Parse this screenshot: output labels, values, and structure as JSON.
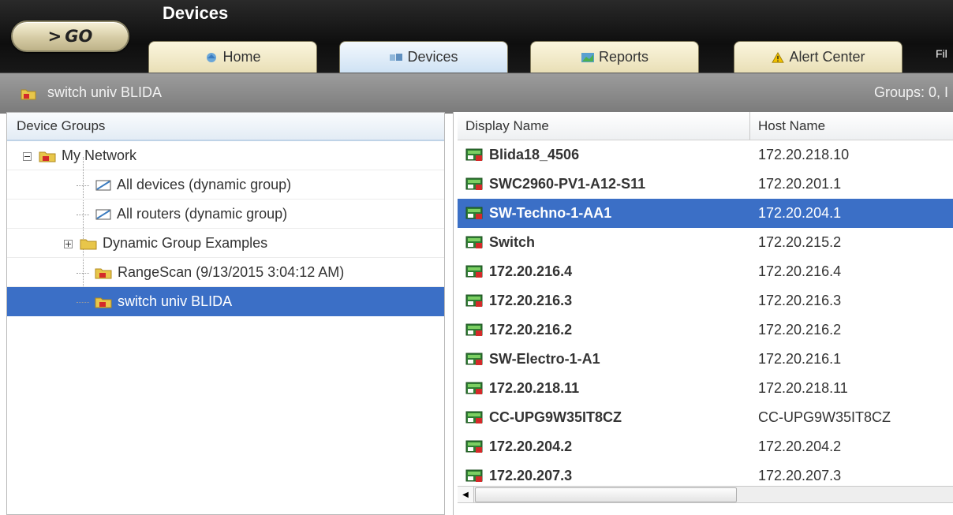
{
  "header": {
    "go_label": "GO",
    "title": "Devices",
    "tabs": [
      {
        "label": "Home"
      },
      {
        "label": "Devices"
      },
      {
        "label": "Reports"
      },
      {
        "label": "Alert Center"
      }
    ],
    "overflow_menu_label": "Fil"
  },
  "titlebar": {
    "title": "switch univ BLIDA",
    "groups_text": "Groups: 0, I"
  },
  "device_groups": {
    "header": "Device Groups",
    "items": [
      {
        "label": "My Network"
      },
      {
        "label": "All devices (dynamic group)"
      },
      {
        "label": "All routers (dynamic group)"
      },
      {
        "label": "Dynamic Group Examples"
      },
      {
        "label": "RangeScan (9/13/2015 3:04:12 AM)"
      },
      {
        "label": "switch univ BLIDA"
      }
    ],
    "selected_index": 5
  },
  "devices_table": {
    "columns": [
      "Display Name",
      "Host Name"
    ],
    "rows": [
      {
        "display_name": "Blida18_4506",
        "host_name": "172.20.218.10"
      },
      {
        "display_name": "SWC2960-PV1-A12-S11",
        "host_name": "172.20.201.1"
      },
      {
        "display_name": "SW-Techno-1-AA1",
        "host_name": "172.20.204.1"
      },
      {
        "display_name": "Switch",
        "host_name": "172.20.215.2"
      },
      {
        "display_name": "172.20.216.4",
        "host_name": "172.20.216.4"
      },
      {
        "display_name": "172.20.216.3",
        "host_name": "172.20.216.3"
      },
      {
        "display_name": "172.20.216.2",
        "host_name": "172.20.216.2"
      },
      {
        "display_name": "SW-Electro-1-A1",
        "host_name": "172.20.216.1"
      },
      {
        "display_name": "172.20.218.11",
        "host_name": "172.20.218.11"
      },
      {
        "display_name": "CC-UPG9W35IT8CZ",
        "host_name": "CC-UPG9W35IT8CZ"
      },
      {
        "display_name": "172.20.204.2",
        "host_name": "172.20.204.2"
      },
      {
        "display_name": "172.20.207.3",
        "host_name": "172.20.207.3"
      }
    ],
    "selected_index": 2
  },
  "colors": {
    "selection": "#3b6fc6",
    "header_bg": "#111111",
    "titlebar_bg": "#8a8a8a"
  }
}
